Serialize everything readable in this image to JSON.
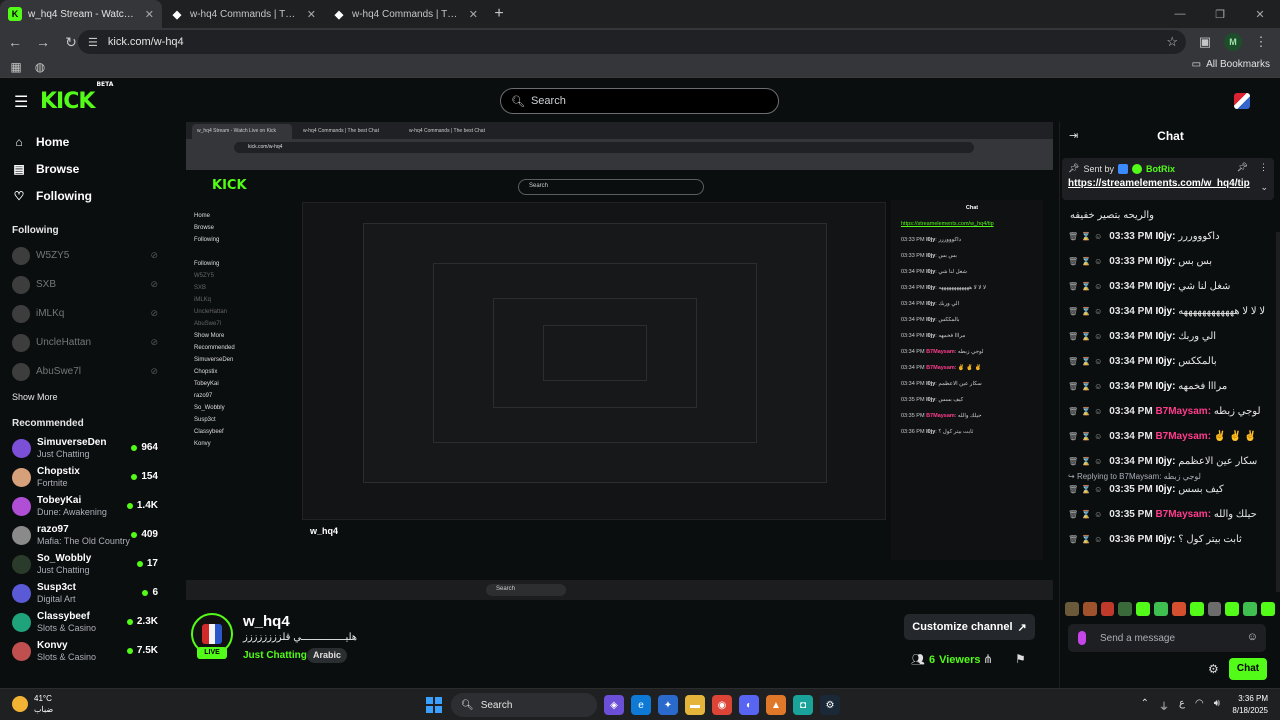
{
  "browser": {
    "tabs": [
      {
        "title": "w_hq4 Stream - Watch Live on Kick",
        "active": true
      },
      {
        "title": "w-hq4 Commands | The best Chat",
        "active": false
      },
      {
        "title": "w-hq4 Commands | The best Chat",
        "active": false
      }
    ],
    "url": "kick.com/w-hq4",
    "all_bookmarks": "All Bookmarks",
    "profile_initial": "M"
  },
  "header": {
    "logo": "KICK",
    "beta": "BETA",
    "search_placeholder": "Search"
  },
  "sidebar": {
    "nav": [
      {
        "label": "Home",
        "icon": "home-icon"
      },
      {
        "label": "Browse",
        "icon": "browse-icon"
      },
      {
        "label": "Following",
        "icon": "heart-icon"
      }
    ],
    "following_title": "Following",
    "following": [
      "W5ZY5",
      "SXB",
      "iMLKq",
      "UncleHattan",
      "AbuSwe7l"
    ],
    "show_more": "Show More",
    "recommended_title": "Recommended",
    "recommended": [
      {
        "name": "SimuverseDen",
        "category": "Just Chatting",
        "viewers": "964",
        "color": "#7b4fd6"
      },
      {
        "name": "Chopstix",
        "category": "Fortnite",
        "viewers": "154",
        "color": "#d6a07b"
      },
      {
        "name": "TobeyKai",
        "category": "Dune: Awakening",
        "viewers": "1.4K",
        "color": "#b04fd6"
      },
      {
        "name": "razo97",
        "category": "Mafia: The Old Country",
        "viewers": "409",
        "color": "#8a8a8a"
      },
      {
        "name": "So_Wobbly",
        "category": "Just Chatting",
        "viewers": "17",
        "color": "#2b3b2b"
      },
      {
        "name": "Susp3ct",
        "category": "Digital Art",
        "viewers": "6",
        "color": "#5a5ad6"
      },
      {
        "name": "Classybeef",
        "category": "Slots & Casino",
        "viewers": "2.3K",
        "color": "#1fa37a"
      },
      {
        "name": "Konvy",
        "category": "Slots & Casino",
        "viewers": "7.5K",
        "color": "#c05050"
      }
    ]
  },
  "video": {
    "inner_url": "kick.com/w-hq4",
    "inner_search": "Search",
    "inner_streamer": "w_hq4"
  },
  "stream": {
    "channel": "w_hq4",
    "title": "هليـــــــــــــــي قلزززززززز",
    "category": "Just Chatting",
    "tag": "Arabic",
    "live": "LIVE",
    "customize": "Customize channel",
    "viewers_count": "6",
    "viewers_label": "Viewers"
  },
  "chat": {
    "title": "Chat",
    "pinned": {
      "sent_by": "Sent by",
      "bot": "BotRix",
      "link": "https://streamelements.com/w_hq4/tip"
    },
    "continuation": "والريحه بتصير خفيفه",
    "messages": [
      {
        "time": "03:33 PM",
        "user": "I0jy",
        "color": "#ffffff",
        "text": "داكوووررر"
      },
      {
        "time": "03:33 PM",
        "user": "I0jy",
        "color": "#ffffff",
        "text": "بس بس"
      },
      {
        "time": "03:34 PM",
        "user": "I0jy",
        "color": "#ffffff",
        "text": "شغل لنا شي"
      },
      {
        "time": "03:34 PM",
        "user": "I0jy",
        "color": "#ffffff",
        "text": "لا لا لا ههههههههههههه"
      },
      {
        "time": "03:34 PM",
        "user": "I0jy",
        "color": "#ffffff",
        "text": "الي وربك"
      },
      {
        "time": "03:34 PM",
        "user": "I0jy",
        "color": "#ffffff",
        "text": "بالمككس"
      },
      {
        "time": "03:34 PM",
        "user": "I0jy",
        "color": "#ffffff",
        "text": "مرااا فخمهه"
      },
      {
        "time": "03:34 PM",
        "user": "B7Maysam",
        "color": "#ff3c8d",
        "text": "لوجي زبطه"
      },
      {
        "time": "03:34 PM",
        "user": "B7Maysam",
        "color": "#ff3c8d",
        "text": "✌ ✌ ✌"
      },
      {
        "time": "03:34 PM",
        "user": "I0jy",
        "color": "#ffffff",
        "text": "سكار عين الاعظمم"
      },
      {
        "time": "03:35 PM",
        "user": "I0jy",
        "color": "#ffffff",
        "text": "كيف بسس",
        "reply": "Replying to B7Maysam: لوجي زبطه"
      },
      {
        "time": "03:35 PM",
        "user": "B7Maysam",
        "color": "#ff3c8d",
        "text": "حيلك والله"
      },
      {
        "time": "03:36 PM",
        "user": "I0jy",
        "color": "#ffffff",
        "text": "ثابت بيتر كول ؟"
      }
    ],
    "input_placeholder": "Send a message",
    "send_label": "Chat"
  },
  "taskbar": {
    "temp": "41°C",
    "weather": "ضباب",
    "search": "Search",
    "time": "3:36 PM",
    "date": "8/18/2025"
  }
}
